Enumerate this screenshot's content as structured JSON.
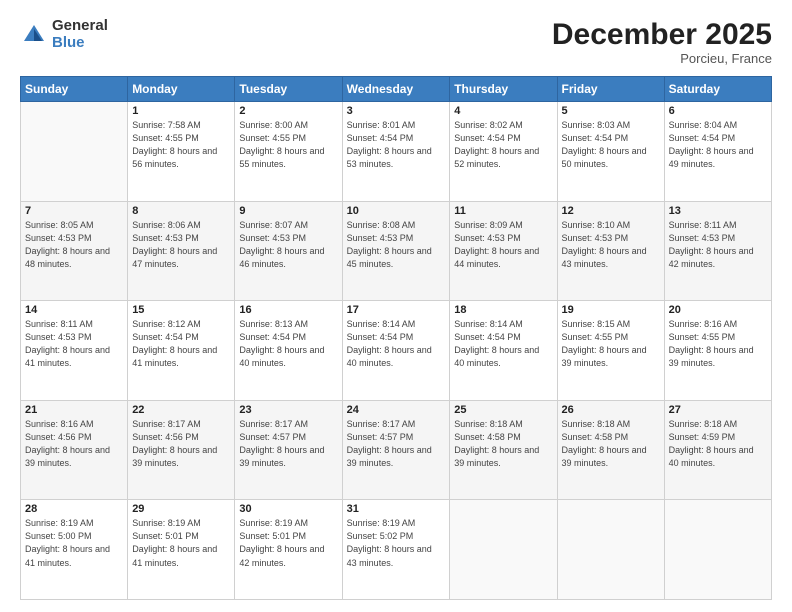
{
  "logo": {
    "general": "General",
    "blue": "Blue"
  },
  "header": {
    "month": "December 2025",
    "location": "Porcieu, France"
  },
  "days_header": [
    "Sunday",
    "Monday",
    "Tuesday",
    "Wednesday",
    "Thursday",
    "Friday",
    "Saturday"
  ],
  "weeks": [
    [
      {
        "day": "",
        "sunrise": "",
        "sunset": "",
        "daylight": ""
      },
      {
        "day": "1",
        "sunrise": "Sunrise: 7:58 AM",
        "sunset": "Sunset: 4:55 PM",
        "daylight": "Daylight: 8 hours and 56 minutes."
      },
      {
        "day": "2",
        "sunrise": "Sunrise: 8:00 AM",
        "sunset": "Sunset: 4:55 PM",
        "daylight": "Daylight: 8 hours and 55 minutes."
      },
      {
        "day": "3",
        "sunrise": "Sunrise: 8:01 AM",
        "sunset": "Sunset: 4:54 PM",
        "daylight": "Daylight: 8 hours and 53 minutes."
      },
      {
        "day": "4",
        "sunrise": "Sunrise: 8:02 AM",
        "sunset": "Sunset: 4:54 PM",
        "daylight": "Daylight: 8 hours and 52 minutes."
      },
      {
        "day": "5",
        "sunrise": "Sunrise: 8:03 AM",
        "sunset": "Sunset: 4:54 PM",
        "daylight": "Daylight: 8 hours and 50 minutes."
      },
      {
        "day": "6",
        "sunrise": "Sunrise: 8:04 AM",
        "sunset": "Sunset: 4:54 PM",
        "daylight": "Daylight: 8 hours and 49 minutes."
      }
    ],
    [
      {
        "day": "7",
        "sunrise": "Sunrise: 8:05 AM",
        "sunset": "Sunset: 4:53 PM",
        "daylight": "Daylight: 8 hours and 48 minutes."
      },
      {
        "day": "8",
        "sunrise": "Sunrise: 8:06 AM",
        "sunset": "Sunset: 4:53 PM",
        "daylight": "Daylight: 8 hours and 47 minutes."
      },
      {
        "day": "9",
        "sunrise": "Sunrise: 8:07 AM",
        "sunset": "Sunset: 4:53 PM",
        "daylight": "Daylight: 8 hours and 46 minutes."
      },
      {
        "day": "10",
        "sunrise": "Sunrise: 8:08 AM",
        "sunset": "Sunset: 4:53 PM",
        "daylight": "Daylight: 8 hours and 45 minutes."
      },
      {
        "day": "11",
        "sunrise": "Sunrise: 8:09 AM",
        "sunset": "Sunset: 4:53 PM",
        "daylight": "Daylight: 8 hours and 44 minutes."
      },
      {
        "day": "12",
        "sunrise": "Sunrise: 8:10 AM",
        "sunset": "Sunset: 4:53 PM",
        "daylight": "Daylight: 8 hours and 43 minutes."
      },
      {
        "day": "13",
        "sunrise": "Sunrise: 8:11 AM",
        "sunset": "Sunset: 4:53 PM",
        "daylight": "Daylight: 8 hours and 42 minutes."
      }
    ],
    [
      {
        "day": "14",
        "sunrise": "Sunrise: 8:11 AM",
        "sunset": "Sunset: 4:53 PM",
        "daylight": "Daylight: 8 hours and 41 minutes."
      },
      {
        "day": "15",
        "sunrise": "Sunrise: 8:12 AM",
        "sunset": "Sunset: 4:54 PM",
        "daylight": "Daylight: 8 hours and 41 minutes."
      },
      {
        "day": "16",
        "sunrise": "Sunrise: 8:13 AM",
        "sunset": "Sunset: 4:54 PM",
        "daylight": "Daylight: 8 hours and 40 minutes."
      },
      {
        "day": "17",
        "sunrise": "Sunrise: 8:14 AM",
        "sunset": "Sunset: 4:54 PM",
        "daylight": "Daylight: 8 hours and 40 minutes."
      },
      {
        "day": "18",
        "sunrise": "Sunrise: 8:14 AM",
        "sunset": "Sunset: 4:54 PM",
        "daylight": "Daylight: 8 hours and 40 minutes."
      },
      {
        "day": "19",
        "sunrise": "Sunrise: 8:15 AM",
        "sunset": "Sunset: 4:55 PM",
        "daylight": "Daylight: 8 hours and 39 minutes."
      },
      {
        "day": "20",
        "sunrise": "Sunrise: 8:16 AM",
        "sunset": "Sunset: 4:55 PM",
        "daylight": "Daylight: 8 hours and 39 minutes."
      }
    ],
    [
      {
        "day": "21",
        "sunrise": "Sunrise: 8:16 AM",
        "sunset": "Sunset: 4:56 PM",
        "daylight": "Daylight: 8 hours and 39 minutes."
      },
      {
        "day": "22",
        "sunrise": "Sunrise: 8:17 AM",
        "sunset": "Sunset: 4:56 PM",
        "daylight": "Daylight: 8 hours and 39 minutes."
      },
      {
        "day": "23",
        "sunrise": "Sunrise: 8:17 AM",
        "sunset": "Sunset: 4:57 PM",
        "daylight": "Daylight: 8 hours and 39 minutes."
      },
      {
        "day": "24",
        "sunrise": "Sunrise: 8:17 AM",
        "sunset": "Sunset: 4:57 PM",
        "daylight": "Daylight: 8 hours and 39 minutes."
      },
      {
        "day": "25",
        "sunrise": "Sunrise: 8:18 AM",
        "sunset": "Sunset: 4:58 PM",
        "daylight": "Daylight: 8 hours and 39 minutes."
      },
      {
        "day": "26",
        "sunrise": "Sunrise: 8:18 AM",
        "sunset": "Sunset: 4:58 PM",
        "daylight": "Daylight: 8 hours and 39 minutes."
      },
      {
        "day": "27",
        "sunrise": "Sunrise: 8:18 AM",
        "sunset": "Sunset: 4:59 PM",
        "daylight": "Daylight: 8 hours and 40 minutes."
      }
    ],
    [
      {
        "day": "28",
        "sunrise": "Sunrise: 8:19 AM",
        "sunset": "Sunset: 5:00 PM",
        "daylight": "Daylight: 8 hours and 41 minutes."
      },
      {
        "day": "29",
        "sunrise": "Sunrise: 8:19 AM",
        "sunset": "Sunset: 5:01 PM",
        "daylight": "Daylight: 8 hours and 41 minutes."
      },
      {
        "day": "30",
        "sunrise": "Sunrise: 8:19 AM",
        "sunset": "Sunset: 5:01 PM",
        "daylight": "Daylight: 8 hours and 42 minutes."
      },
      {
        "day": "31",
        "sunrise": "Sunrise: 8:19 AM",
        "sunset": "Sunset: 5:02 PM",
        "daylight": "Daylight: 8 hours and 43 minutes."
      },
      {
        "day": "",
        "sunrise": "",
        "sunset": "",
        "daylight": ""
      },
      {
        "day": "",
        "sunrise": "",
        "sunset": "",
        "daylight": ""
      },
      {
        "day": "",
        "sunrise": "",
        "sunset": "",
        "daylight": ""
      }
    ]
  ]
}
